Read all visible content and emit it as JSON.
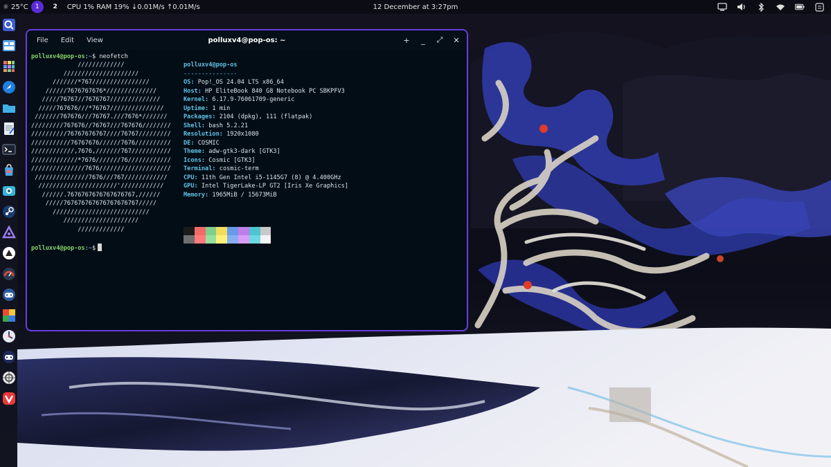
{
  "top_panel": {
    "temperature": "25°C",
    "workspaces": [
      "1",
      "2"
    ],
    "sysmon": "CPU 1% RAM 19% ↓0.01M/s ↑0.01M/s",
    "clock": "12 December at 3:27pm"
  },
  "dock": {
    "apps": [
      "magnifier-app",
      "workspaces-app",
      "app-library",
      "browser",
      "files",
      "text-editor",
      "terminal",
      "store",
      "camera-app",
      "steam",
      "proton-app",
      "notes-app",
      "gauge-app",
      "gamepad-app",
      "multi-app",
      "tools-app",
      "gamepad-2-app",
      "aperture-app",
      "vivaldi-app"
    ]
  },
  "terminal": {
    "menu": [
      "File",
      "Edit",
      "View"
    ],
    "title": "polluxv4@pop-os: ~",
    "controls": [
      "+",
      "_",
      "⤢",
      "✕"
    ],
    "prompt_user": "polluxv4@pop-os",
    "prompt_path": "~",
    "prompt_sep": ":",
    "prompt_sym": "$",
    "command": "neofetch",
    "ascii_art": "             /////////////\n         /////////////////////\n      ///////*767////////////////\n    //////7676767676*//////////////\n   /////76767//7676767//////////////\n  /////767676///*76767///////////////\n ///////767676///76767.///7676*///////\n/////////767676//76767///767676////////\n//////////76767676767////76767/////////\n///////////76767676//////7676//////////\n////////////,7676,///////767///////////\n/////////////*7676///////76////////////\n///////////////7676////////////////////\n ///////////////7676///767////////////\n  //////////////////////'////////////\n   //////.7676767676767676767,//////\n    /////767676767676767676767/////\n      ///////////////////////////\n         /////////////////////\n             /////////////",
    "info_title": "polluxv4@pop-os",
    "info_sep": "---------------",
    "info": [
      {
        "key": "OS",
        "value": "Pop!_OS 24.04 LTS x86_64"
      },
      {
        "key": "Host",
        "value": "HP EliteBook 840 G8 Notebook PC SBKPFV3"
      },
      {
        "key": "Kernel",
        "value": "6.17.9-76061709-generic"
      },
      {
        "key": "Uptime",
        "value": "1 min"
      },
      {
        "key": "Packages",
        "value": "2104 (dpkg), 111 (flatpak)"
      },
      {
        "key": "Shell",
        "value": "bash 5.2.21"
      },
      {
        "key": "Resolution",
        "value": "1920x1080"
      },
      {
        "key": "DE",
        "value": "COSMIC"
      },
      {
        "key": "Theme",
        "value": "adw-gtk3-dark [GTK3]"
      },
      {
        "key": "Icons",
        "value": "Cosmic [GTK3]"
      },
      {
        "key": "Terminal",
        "value": "cosmic-term"
      },
      {
        "key": "CPU",
        "value": "11th Gen Intel i5-1145G7 (8) @ 4.400GHz"
      },
      {
        "key": "GPU",
        "value": "Intel TigerLake-LP GT2 [Iris Xe Graphics]"
      },
      {
        "key": "Memory",
        "value": "1965MiB / 15673MiB"
      }
    ],
    "palette_top": [
      "#1b1b1b",
      "#f06a6a",
      "#7fd08a",
      "#f2dc5e",
      "#6a98e8",
      "#c27ee8",
      "#4fc4d0",
      "#c8c8c8"
    ],
    "palette_bottom": [
      "#6e6e6e",
      "#ff7a7a",
      "#96e0a0",
      "#fff07a",
      "#86aef5",
      "#da9cf8",
      "#6cd8e2",
      "#f2f2f2"
    ]
  },
  "colors": {
    "accent": "#6a3ee0",
    "active_workspace": "#5b2bd6",
    "terminal_bg": "#020d16"
  }
}
